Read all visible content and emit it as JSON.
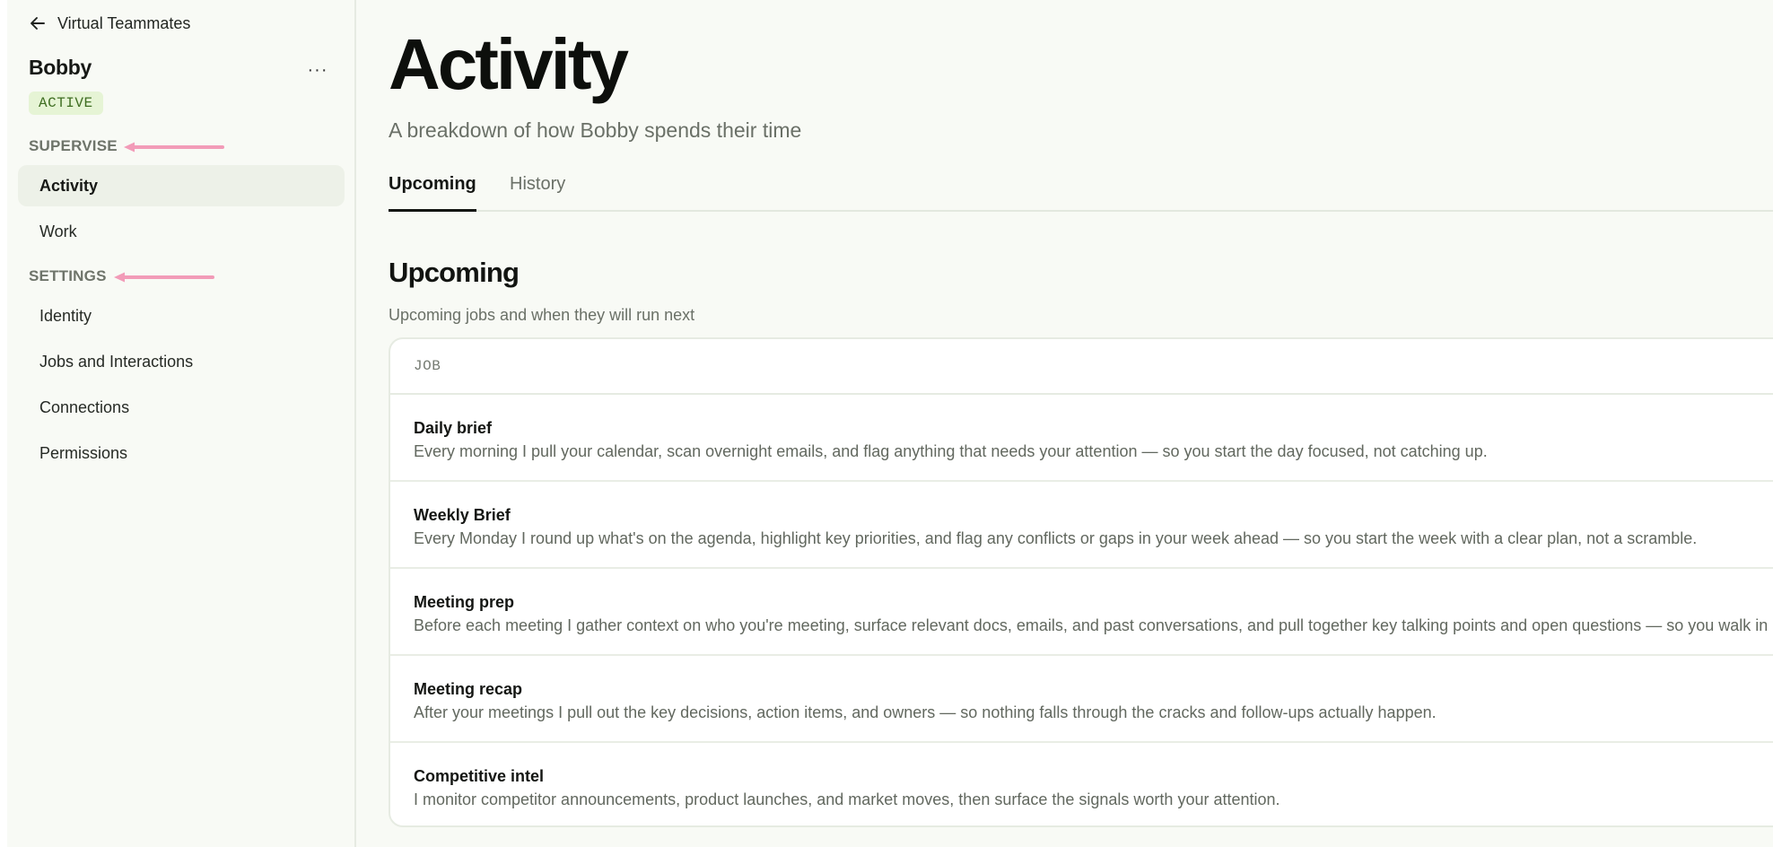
{
  "sidebar": {
    "back_label": "Virtual Teammates",
    "agent_name": "Bobby",
    "more_label": "···",
    "status": "ACTIVE",
    "sections": [
      {
        "label": "SUPERVISE",
        "items": [
          {
            "label": "Activity",
            "active": true
          },
          {
            "label": "Work",
            "active": false
          }
        ]
      },
      {
        "label": "SETTINGS",
        "items": [
          {
            "label": "Identity",
            "active": false
          },
          {
            "label": "Jobs and Interactions",
            "active": false
          },
          {
            "label": "Connections",
            "active": false
          },
          {
            "label": "Permissions",
            "active": false
          }
        ]
      }
    ]
  },
  "main": {
    "title": "Activity",
    "subtitle": "A breakdown of how Bobby spends their time",
    "tabs": [
      {
        "label": "Upcoming",
        "active": true
      },
      {
        "label": "History",
        "active": false
      }
    ],
    "section_title": "Upcoming",
    "section_desc": "Upcoming jobs and when they will run next",
    "table": {
      "column_header": "JOB",
      "rows": [
        {
          "name": "Daily brief",
          "description": "Every morning I pull your calendar, scan overnight emails, and flag anything that needs your attention — so you start the day focused, not catching up."
        },
        {
          "name": "Weekly Brief",
          "description": "Every Monday I round up what's on the agenda, highlight key priorities, and flag any conflicts or gaps in your week ahead — so you start the week with a clear plan, not a scramble."
        },
        {
          "name": "Meeting prep",
          "description": "Before each meeting I gather context on who you're meeting, surface relevant docs, emails, and past conversations, and pull together key talking points and open questions — so you walk in ready."
        },
        {
          "name": "Meeting recap",
          "description": "After your meetings I pull out the key decisions, action items, and owners — so nothing falls through the cracks and follow-ups actually happen."
        },
        {
          "name": "Competitive intel",
          "description": "I monitor competitor announcements, product launches, and market moves, then surface the signals worth your attention."
        }
      ]
    }
  },
  "colors": {
    "background": "#f8faf5",
    "active_badge_bg": "#e6f4d5",
    "active_badge_text": "#3f6e22",
    "annotation_arrow": "#f29bb8"
  },
  "icons": {
    "back": "arrow-left-icon",
    "more": "ellipsis-icon",
    "annotation": "pink-arrow-icon"
  }
}
